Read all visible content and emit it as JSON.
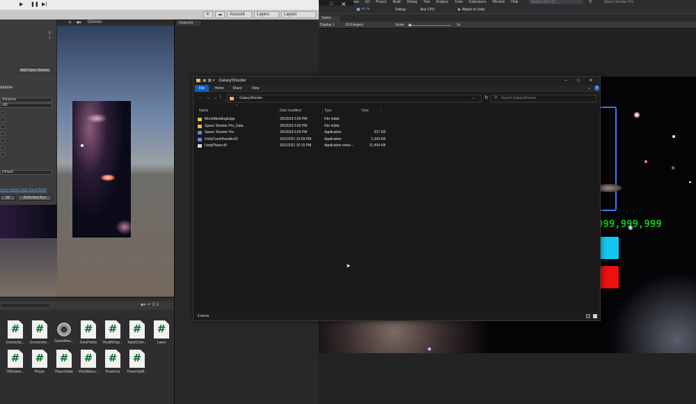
{
  "unity": {
    "toolbar": {
      "account_label": "Account",
      "layers_label": "Layers",
      "layout_label": "Layout"
    },
    "build_panel": {
      "numbers": [
        "0",
        "1"
      ],
      "add_open_scenes_label": "Add Open Scenes",
      "platform_partial": "dalone",
      "target_platform": "Windows",
      "architecture": "x86",
      "compression": "Default",
      "cloud_build_link": "Learn about Unity Cloud Build",
      "build_label": "ild",
      "build_and_run_label": "Build And Run"
    },
    "scene": {
      "gizmos_label": "Gizmos"
    },
    "inspector": {
      "tab_label": "Inspector"
    },
    "project_assets": [
      {
        "label": "EnemySp...",
        "type": "script"
      },
      {
        "label": "Environme...",
        "type": "script"
      },
      {
        "label": "GameMan...",
        "type": "gear"
      },
      {
        "label": "GivePoints",
        "type": "script"
      },
      {
        "label": "HealthDisp...",
        "type": "script"
      },
      {
        "label": "InputContr...",
        "type": "script"
      },
      {
        "label": "Laser",
        "type": "script"
      },
      {
        "label": "Offensive...",
        "type": "script"
      },
      {
        "label": "Player",
        "type": "script"
      },
      {
        "label": "PlayerState",
        "type": "script"
      },
      {
        "label": "PointManа...",
        "type": "script"
      },
      {
        "label": "PowerUp",
        "type": "script"
      },
      {
        "label": "PowerUpM...",
        "type": "script"
      }
    ]
  },
  "visual_studio": {
    "menu": [
      "iew",
      "Git",
      "Project",
      "Build",
      "Debug",
      "Test",
      "Analyze",
      "Tools",
      "Extensions",
      "Window",
      "Help"
    ],
    "search_placeholder": "Search (Ctrl+Q)",
    "solution_name": "Space Shooter Pro",
    "config": "Debug",
    "platform": "Any CPU",
    "attach_label": "Attach to Unity"
  },
  "game_view": {
    "tab_label": "Game",
    "display": "Display 1",
    "aspect": "16:9 Aspect",
    "scale_label": "Scale",
    "scale_value": "1x",
    "score_text": "999,999,999"
  },
  "explorer": {
    "title": "GalaxyShooter",
    "ribbon_tabs": [
      "File",
      "Home",
      "Share",
      "View"
    ],
    "path": "GalaxyShooter",
    "search_placeholder": "Search GalaxyShooter",
    "columns": [
      "Name",
      "Date modified",
      "Type",
      "Size"
    ],
    "rows": [
      {
        "name": "MonoBleedingEdge",
        "date": "3/5/2023 5:55 PM",
        "type": "File folder",
        "size": "",
        "icon": "folder"
      },
      {
        "name": "Space Shooter Pro_Data",
        "date": "3/5/2023 6:03 PM",
        "type": "File folder",
        "size": "",
        "icon": "folder"
      },
      {
        "name": "Space Shooter Pro",
        "date": "3/5/2023 6:03 PM",
        "type": "Application",
        "size": "627 KB",
        "icon": "app"
      },
      {
        "name": "UnityCrashHandler32",
        "date": "3/31/2021 10:09 PM",
        "type": "Application",
        "size": "1,043 KB",
        "icon": "app"
      },
      {
        "name": "UnityPlayer.dll",
        "date": "3/31/2021 10:15 PM",
        "type": "Application exten...",
        "size": "21,494 KB",
        "icon": "dll"
      }
    ],
    "status": "5 items"
  },
  "colors": {
    "accent_blue": "#0b5fc6",
    "score_green": "#12c312",
    "cyan_button": "#11c8ef",
    "red_button": "#ec1010"
  }
}
